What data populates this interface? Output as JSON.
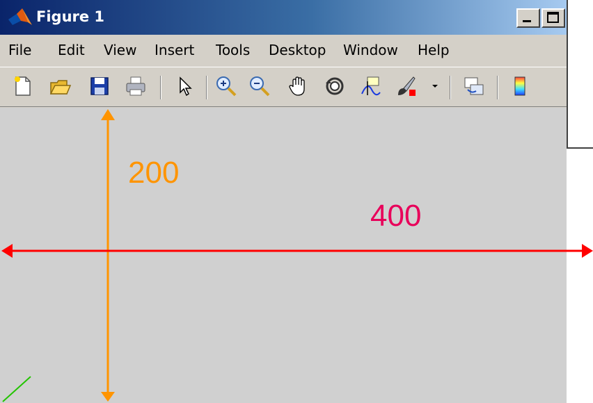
{
  "window": {
    "title": "Figure 1",
    "controls": {
      "minimize": "minimize",
      "maximize": "maximize"
    }
  },
  "menu": {
    "items": [
      {
        "label": "File"
      },
      {
        "label": "Edit"
      },
      {
        "label": "View"
      },
      {
        "label": "Insert"
      },
      {
        "label": "Tools"
      },
      {
        "label": "Desktop"
      },
      {
        "label": "Window"
      },
      {
        "label": "Help"
      }
    ]
  },
  "toolbar": {
    "icons": [
      "new-figure-icon",
      "open-file-icon",
      "save-icon",
      "print-icon",
      "select-arrow-icon",
      "zoom-in-icon",
      "zoom-out-icon",
      "pan-hand-icon",
      "rotate-3d-icon",
      "data-cursor-icon",
      "brush-icon",
      "dropdown-arrow-icon",
      "link-plot-icon",
      "colorbar-icon"
    ]
  },
  "annotations": {
    "vertical_label": "200",
    "horizontal_label": "400",
    "vertical_color": "#ff9400",
    "horizontal_color": "#ff0000",
    "horizontal_label_color": "#e8005a",
    "corner_line_color": "#22c400"
  }
}
